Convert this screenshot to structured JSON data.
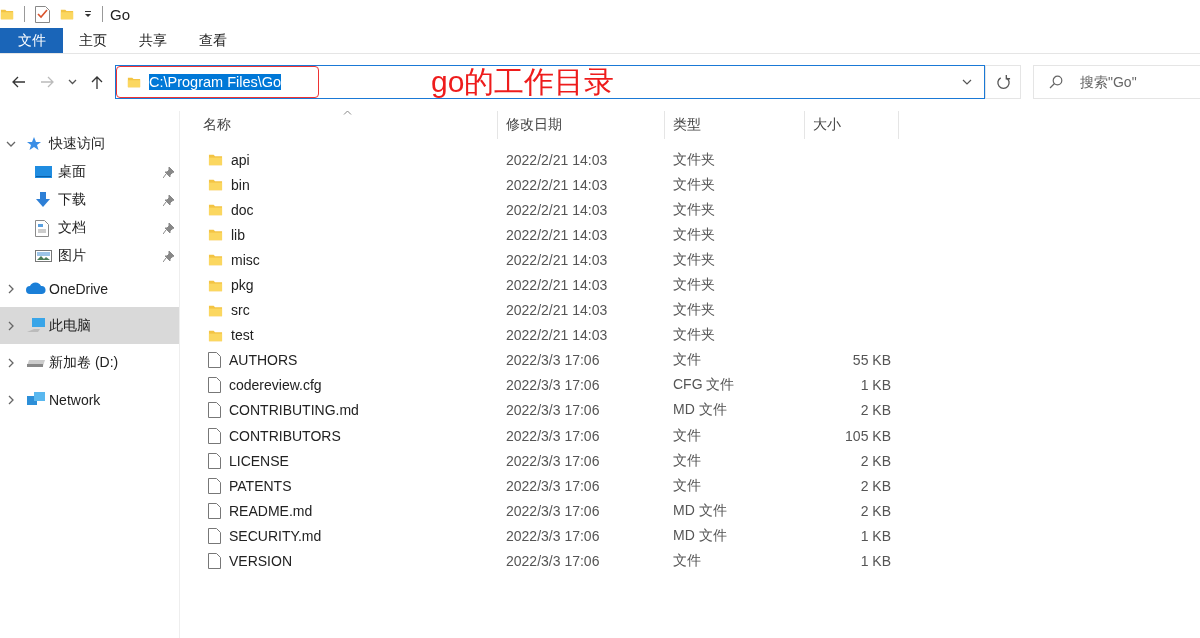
{
  "window": {
    "title": "Go"
  },
  "ribbon_tabs": [
    {
      "label": "文件",
      "kind": "file",
      "selected": false
    },
    {
      "label": "主页",
      "kind": "tab",
      "selected": false
    },
    {
      "label": "共享",
      "kind": "tab",
      "selected": false
    },
    {
      "label": "查看",
      "kind": "tab",
      "selected": false
    }
  ],
  "address_bar": {
    "value": "C:\\Program Files\\Go",
    "text_selected": true
  },
  "annotation": {
    "text": "go的工作目录"
  },
  "search": {
    "placeholder": "搜索\"Go\""
  },
  "sidebar": {
    "items": [
      {
        "label": "快速访问",
        "kind": "star",
        "expanded": true,
        "selected": false,
        "children": [
          {
            "label": "桌面",
            "kind": "desktop",
            "pinned": true
          },
          {
            "label": "下载",
            "kind": "download",
            "pinned": true
          },
          {
            "label": "文档",
            "kind": "document",
            "pinned": true
          },
          {
            "label": "图片",
            "kind": "pictures",
            "pinned": true
          }
        ]
      },
      {
        "label": "OneDrive",
        "kind": "cloud",
        "expanded": false,
        "selected": false
      },
      {
        "label": "此电脑",
        "kind": "computer",
        "expanded": false,
        "selected": true
      },
      {
        "label": "新加卷 (D:)",
        "kind": "drive",
        "expanded": false,
        "selected": false
      },
      {
        "label": "Network",
        "kind": "network",
        "expanded": false,
        "selected": false
      }
    ]
  },
  "table": {
    "columns": [
      "名称",
      "修改日期",
      "类型",
      "大小"
    ],
    "rows": [
      {
        "kind": "folder",
        "name": "api",
        "modified": "2022/2/21 14:03",
        "type": "文件夹"
      },
      {
        "kind": "folder",
        "name": "bin",
        "modified": "2022/2/21 14:03",
        "type": "文件夹"
      },
      {
        "kind": "folder",
        "name": "doc",
        "modified": "2022/2/21 14:03",
        "type": "文件夹"
      },
      {
        "kind": "folder",
        "name": "lib",
        "modified": "2022/2/21 14:03",
        "type": "文件夹"
      },
      {
        "kind": "folder",
        "name": "misc",
        "modified": "2022/2/21 14:03",
        "type": "文件夹"
      },
      {
        "kind": "folder",
        "name": "pkg",
        "modified": "2022/2/21 14:03",
        "type": "文件夹"
      },
      {
        "kind": "folder",
        "name": "src",
        "modified": "2022/2/21 14:03",
        "type": "文件夹"
      },
      {
        "kind": "folder",
        "name": "test",
        "modified": "2022/2/21 14:03",
        "type": "文件夹"
      },
      {
        "kind": "file",
        "name": "AUTHORS",
        "modified": "2022/3/3 17:06",
        "type": "文件",
        "size": "55 KB"
      },
      {
        "kind": "file",
        "name": "codereview.cfg",
        "modified": "2022/3/3 17:06",
        "type": "CFG 文件",
        "size": "1 KB"
      },
      {
        "kind": "file",
        "name": "CONTRIBUTING.md",
        "modified": "2022/3/3 17:06",
        "type": "MD 文件",
        "size": "2 KB"
      },
      {
        "kind": "file",
        "name": "CONTRIBUTORS",
        "modified": "2022/3/3 17:06",
        "type": "文件",
        "size": "105 KB"
      },
      {
        "kind": "file",
        "name": "LICENSE",
        "modified": "2022/3/3 17:06",
        "type": "文件",
        "size": "2 KB"
      },
      {
        "kind": "file",
        "name": "PATENTS",
        "modified": "2022/3/3 17:06",
        "type": "文件",
        "size": "2 KB"
      },
      {
        "kind": "file",
        "name": "README.md",
        "modified": "2022/3/3 17:06",
        "type": "MD 文件",
        "size": "2 KB"
      },
      {
        "kind": "file",
        "name": "SECURITY.md",
        "modified": "2022/3/3 17:06",
        "type": "MD 文件",
        "size": "1 KB"
      },
      {
        "kind": "file",
        "name": "VERSION",
        "modified": "2022/3/3 17:06",
        "type": "文件",
        "size": "1 KB"
      }
    ]
  }
}
